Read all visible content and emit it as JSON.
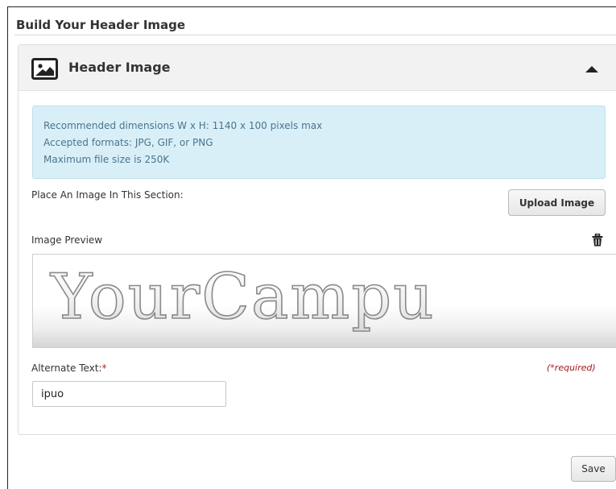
{
  "page": {
    "title": "Build Your Header Image"
  },
  "panel": {
    "title": "Header Image",
    "header_icon": "image-icon",
    "collapse_icon": "caret-up-icon",
    "info": {
      "line1": "Recommended dimensions W x H: 1140 x 100 pixels max",
      "line2": "Accepted formats: JPG, GIF, or PNG",
      "line3": "Maximum file size is 250K"
    },
    "place_label": "Place An Image In This Section:",
    "upload_label": "Upload Image",
    "preview_label": "Image Preview",
    "delete_icon": "trash-icon",
    "preview_text": "YourCampu",
    "alt_label": "Alternate Text:",
    "alt_required_mark": "*",
    "required_note": "(*required)",
    "alt_value": "ipuo"
  },
  "footer": {
    "save_label": "Save"
  },
  "colors": {
    "info_bg": "#d9eff7",
    "info_text": "#4a7490",
    "required": "#a01c1c",
    "header_bg": "#f2f2f2"
  }
}
